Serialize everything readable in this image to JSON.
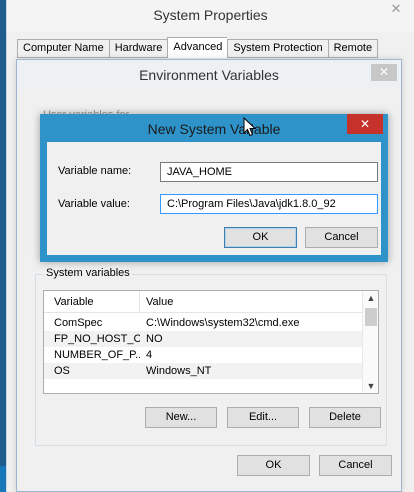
{
  "system_properties": {
    "title": "System Properties",
    "tabs": [
      "Computer Name",
      "Hardware",
      "Advanced",
      "System Protection",
      "Remote"
    ],
    "active_tab": "Advanced"
  },
  "environment_variables": {
    "title": "Environment Variables",
    "user_vars_label": "User variables for ...",
    "system_variables": {
      "label": "System variables",
      "columns": [
        "Variable",
        "Value"
      ],
      "rows": [
        {
          "variable": "ComSpec",
          "value": "C:\\Windows\\system32\\cmd.exe"
        },
        {
          "variable": "FP_NO_HOST_C...",
          "value": "NO"
        },
        {
          "variable": "NUMBER_OF_P...",
          "value": "4"
        },
        {
          "variable": "OS",
          "value": "Windows_NT"
        }
      ],
      "buttons": {
        "new": "New...",
        "edit": "Edit...",
        "delete": "Delete"
      }
    },
    "ok_label": "OK",
    "cancel_label": "Cancel"
  },
  "new_system_variable": {
    "title": "New System Variable",
    "name_label": "Variable name:",
    "name_value": "JAVA_HOME",
    "value_label": "Variable value:",
    "value_value": "C:\\Program Files\\Java\\jdk1.8.0_92",
    "ok_label": "OK",
    "cancel_label": "Cancel"
  },
  "icons": {
    "close": "close-icon",
    "scroll_up": "scroll-up-icon",
    "scroll_down": "scroll-down-icon",
    "cursor": "mouse-cursor-icon"
  },
  "colors": {
    "dialog_accent": "#2d93c9",
    "close_button_active": "#c7312b",
    "default_button_border": "#3c7fb1"
  }
}
